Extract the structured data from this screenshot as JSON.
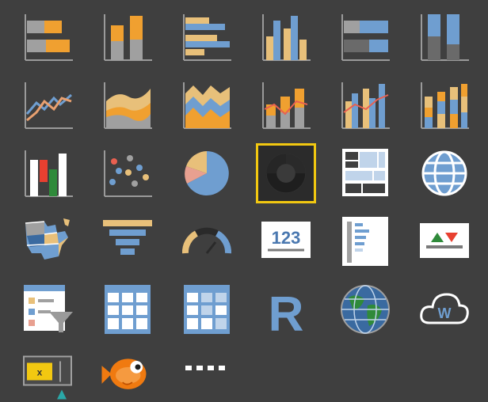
{
  "colors": {
    "background": "#3f3f3f",
    "axis": "#9a9a9a",
    "orange": "#f0a030",
    "tan": "#e8c07a",
    "blue": "#6f9ed0",
    "gray": "#a0a0a0",
    "dark_gray": "#6a6a6a",
    "white": "#ffffff",
    "selection": "#f2c811"
  },
  "visualizations": [
    {
      "icon": "stacked-bar-chart-icon"
    },
    {
      "icon": "stacked-column-chart-icon"
    },
    {
      "icon": "clustered-bar-chart-icon"
    },
    {
      "icon": "clustered-column-chart-icon"
    },
    {
      "icon": "100-percent-stacked-bar-chart-icon"
    },
    {
      "icon": "100-percent-stacked-column-chart-icon"
    },
    {
      "icon": "line-chart-icon"
    },
    {
      "icon": "area-chart-icon"
    },
    {
      "icon": "stacked-area-chart-icon"
    },
    {
      "icon": "line-and-stacked-column-chart-icon"
    },
    {
      "icon": "line-and-clustered-column-chart-icon"
    },
    {
      "icon": "ribbon-chart-icon"
    },
    {
      "icon": "waterfall-chart-icon"
    },
    {
      "icon": "scatter-chart-icon"
    },
    {
      "icon": "pie-chart-icon"
    },
    {
      "icon": "donut-chart-icon",
      "selected": true
    },
    {
      "icon": "treemap-icon"
    },
    {
      "icon": "map-icon"
    },
    {
      "icon": "filled-map-icon"
    },
    {
      "icon": "funnel-icon"
    },
    {
      "icon": "gauge-icon"
    },
    {
      "icon": "card-icon",
      "text": "123"
    },
    {
      "icon": "multi-row-card-icon"
    },
    {
      "icon": "kpi-icon"
    },
    {
      "icon": "slicer-icon"
    },
    {
      "icon": "table-icon"
    },
    {
      "icon": "matrix-icon"
    },
    {
      "icon": "r-script-visual-icon",
      "text": "R"
    },
    {
      "icon": "globe-map-icon"
    },
    {
      "icon": "word-cloud-icon",
      "text": "W"
    },
    {
      "icon": "custom-visual-icon"
    },
    {
      "icon": "fish-custom-visual-icon"
    },
    {
      "icon": "more-visuals-icon"
    }
  ]
}
